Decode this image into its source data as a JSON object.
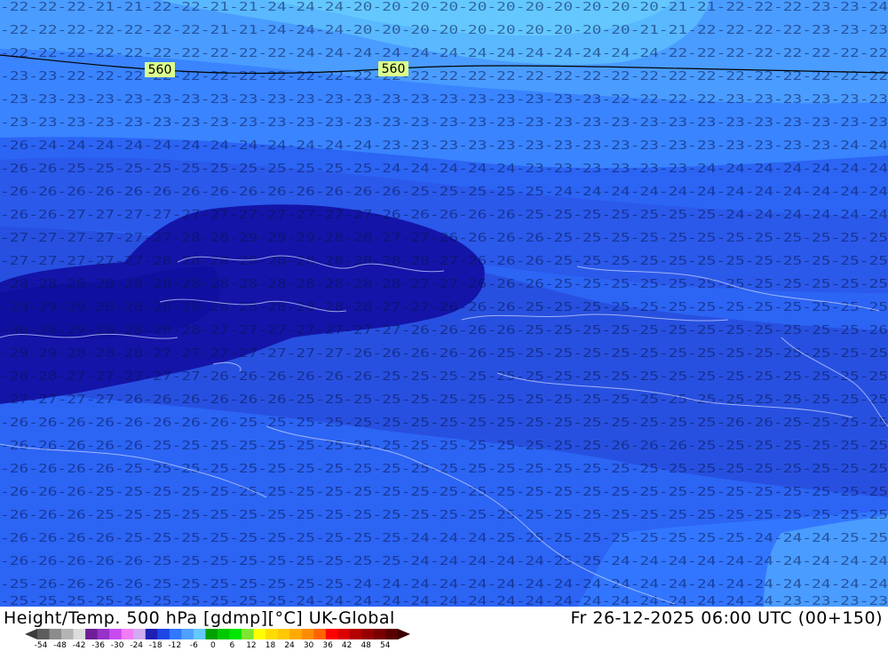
{
  "map": {
    "contour_label": "560",
    "temperature_levels": [
      "-22",
      "-23",
      "-24",
      "-25",
      "-26",
      "-27",
      "-28",
      "-29",
      "-30",
      "-20",
      "-21"
    ]
  },
  "footer": {
    "title": "Height/Temp. 500 hPa [gdmp][°C] UK-Global",
    "valid_time": "Fr 26-12-2025 06:00 UTC (00+150)"
  },
  "scale": {
    "tick_labels": [
      "-54",
      "-48",
      "-42",
      "-36",
      "-30",
      "-24",
      "-18",
      "-12",
      "-6",
      "0",
      "6",
      "12",
      "18",
      "24",
      "30",
      "36",
      "42",
      "48",
      "54"
    ],
    "colors": [
      "#5c5c5c",
      "#8c8c8c",
      "#b4b4b4",
      "#dcdcdc",
      "#6e1e96",
      "#9632c8",
      "#c84bf0",
      "#f07df5",
      "#d2aaf0",
      "#1e1eb4",
      "#1e46e6",
      "#3278ff",
      "#50a0ff",
      "#64c8ff",
      "#00a000",
      "#00c800",
      "#00e600",
      "#7de632",
      "#ffff00",
      "#ffdc00",
      "#ffc800",
      "#ffaa00",
      "#ff8c00",
      "#ff6400",
      "#ff0000",
      "#dc0000",
      "#b40000",
      "#960000",
      "#780000",
      "#5a0000"
    ]
  }
}
